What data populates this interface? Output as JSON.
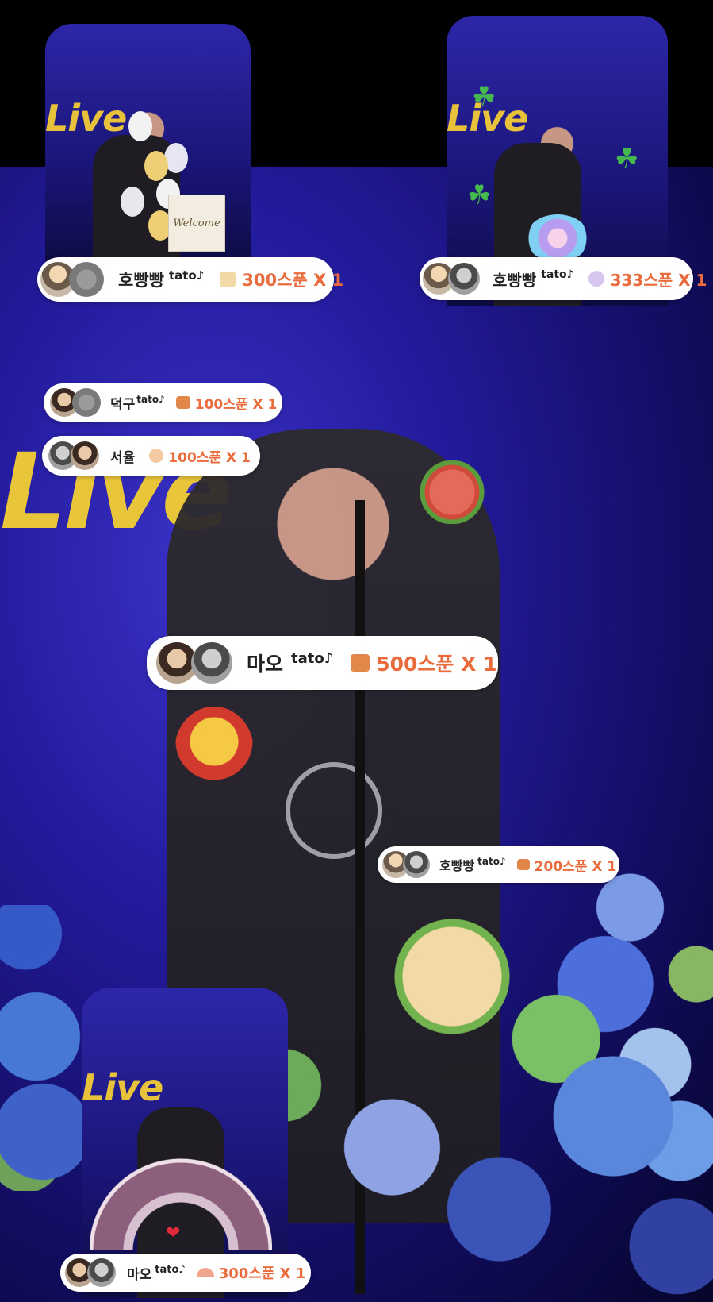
{
  "background": {
    "stage_text": "Live"
  },
  "photo_cards": [
    {
      "live_text": "Live",
      "extra": "Welcome"
    },
    {
      "live_text": "Live",
      "extra": ""
    },
    {
      "live_text": "Live",
      "extra": ""
    }
  ],
  "welcome_sign": "Welcome",
  "gifts": [
    {
      "sender": "호빵빵",
      "tag": "tato♪",
      "amount": "300스푼 X 1",
      "icon": "gift-cake-icon"
    },
    {
      "sender": "호빵빵",
      "tag": "tato♪",
      "amount": "333스푼 X 1",
      "icon": "gift-shell-icon"
    },
    {
      "sender": "덕구",
      "tag": "tato♪",
      "amount": "100스푼 X 1",
      "icon": "gift-box-icon"
    },
    {
      "sender": "서율",
      "tag": "",
      "amount": "100스푼 X 1",
      "icon": "gift-sparkle-icon"
    },
    {
      "sender": "마오",
      "tag": "tato♪",
      "amount": "500스푼 X 1",
      "icon": "gift-box-icon"
    },
    {
      "sender": "호빵빵",
      "tag": "tato♪",
      "amount": "200스푼 X 1",
      "icon": "gift-box-icon"
    },
    {
      "sender": "마오",
      "tag": "tato♪",
      "amount": "300스푼 X 1",
      "icon": "gift-fan-icon"
    }
  ]
}
